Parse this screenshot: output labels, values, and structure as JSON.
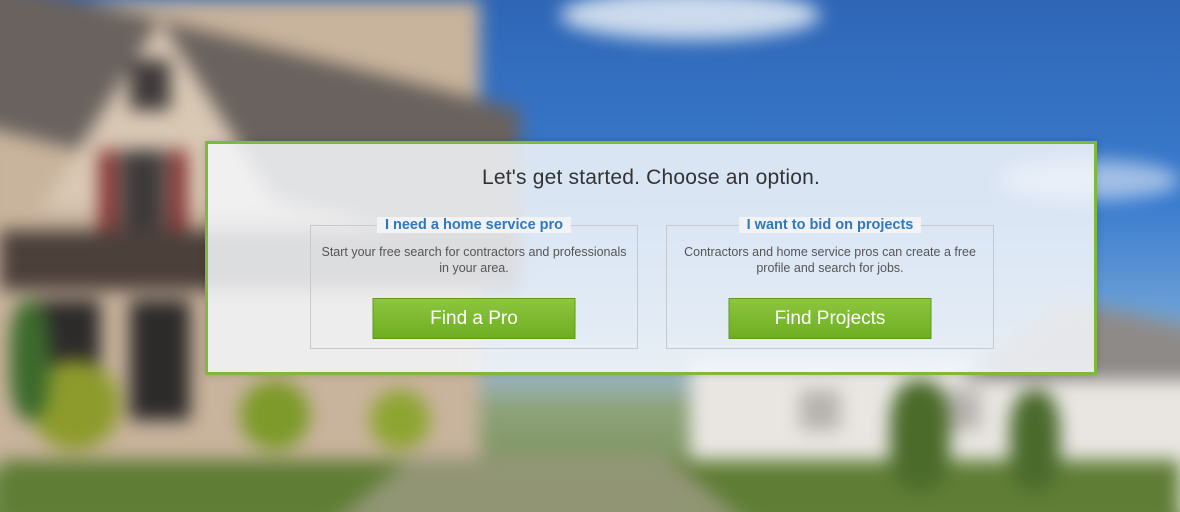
{
  "panel": {
    "headline": "Let's get started. Choose an option."
  },
  "options": [
    {
      "legend": "I need a home service pro",
      "description": "Start your free search for contractors and professionals in your area.",
      "button_label": "Find a Pro"
    },
    {
      "legend": "I want to bid on projects",
      "description": "Contractors and home service pros can create a free profile and search for jobs.",
      "button_label": "Find Projects"
    }
  ],
  "colors": {
    "accent_green": "#7fb93a",
    "button_green": "#78b52c",
    "link_blue": "#2f78bf"
  }
}
